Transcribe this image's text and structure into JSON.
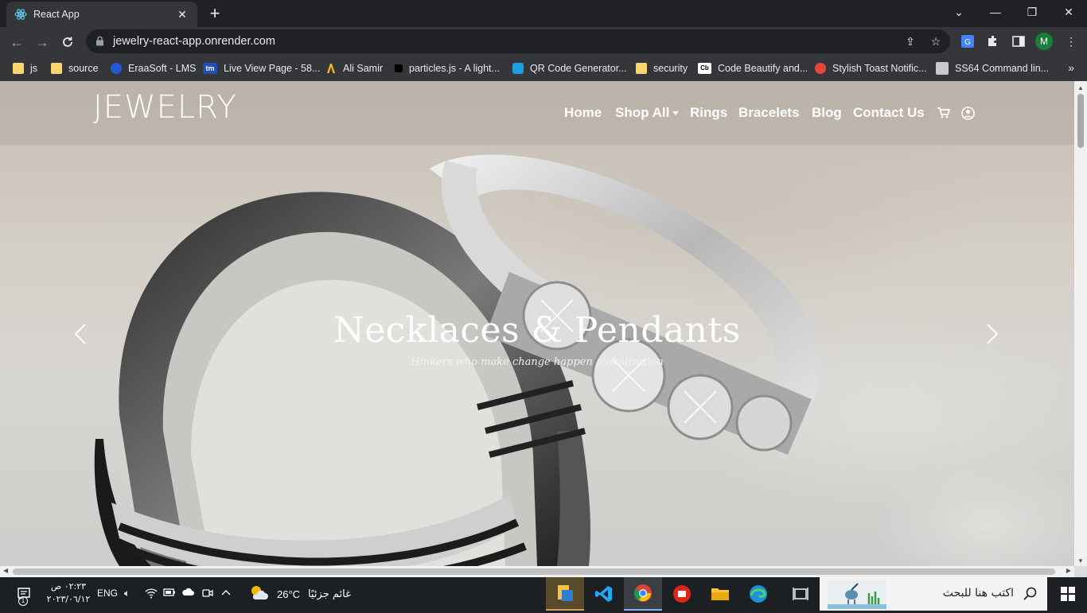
{
  "browser": {
    "tab_title": "React App",
    "url": "jewelry-react-app.onrender.com",
    "profile_initial": "M",
    "bookmarks": [
      {
        "label": "js",
        "icon": "folder-icon"
      },
      {
        "label": "source",
        "icon": "folder-icon"
      },
      {
        "label": "EraaSoft - LMS",
        "icon": "eraasoft-icon"
      },
      {
        "label": "Live View Page - 58...",
        "icon": "tm-icon"
      },
      {
        "label": "Ali Samir",
        "icon": "ali-samir-icon"
      },
      {
        "label": "particles.js - A light...",
        "icon": "particles-icon"
      },
      {
        "label": "QR Code Generator...",
        "icon": "qr-icon"
      },
      {
        "label": "security",
        "icon": "folder-icon"
      },
      {
        "label": "Code Beautify and...",
        "icon": "cb-icon"
      },
      {
        "label": "Stylish Toast Notific...",
        "icon": "toast-icon"
      },
      {
        "label": "SS64 Command lin...",
        "icon": "ss64-icon"
      }
    ],
    "bookmark_icon_text": {
      "tm": "tm",
      "cb": "Cb"
    }
  },
  "site": {
    "logo": "JEWELRY",
    "nav": {
      "home": "Home",
      "shop_all": "Shop All",
      "rings": "Rings",
      "bracelets": "Bracelets",
      "blog": "Blog",
      "contact": "Contact Us"
    },
    "hero": {
      "title": "Necklaces & Pendants",
      "subtitle": "Hinkers who make change happen globalization"
    }
  },
  "taskbar": {
    "search_placeholder": "اكتب هنا للبحث",
    "weather_temp": "26°C",
    "weather_text": "غائم جزئيًا",
    "language": "ENG",
    "time": "٠٢:٢٣ ص",
    "date": "٢٠٢٣/٠٦/١٢",
    "notification_count": "1"
  },
  "colors": {
    "chrome_dark": "#202124",
    "chrome_toolbar": "#35363a",
    "profile": "#188038",
    "taskbar": "#1c2023"
  }
}
